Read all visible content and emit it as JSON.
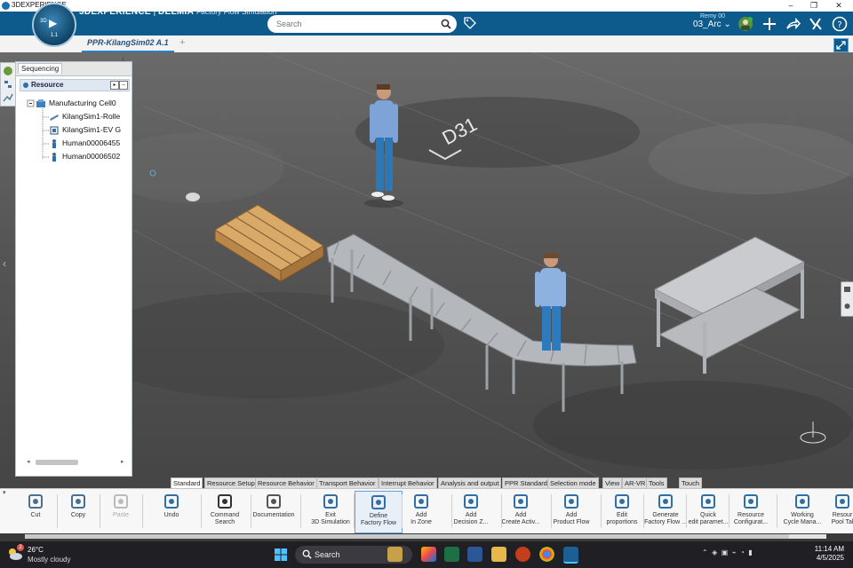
{
  "window": {
    "title": "3DEXPERIENCE",
    "controls": [
      "–",
      "❐",
      "✕"
    ]
  },
  "topbar": {
    "brand_bold": "3DEXPERIENCE",
    "brand_separator": " | ",
    "brand_app": "DELMIA",
    "brand_sub": "Factory Flow Simulation",
    "compass_3d": "3D",
    "compass_version": "1.1",
    "search_placeholder": "Search",
    "user_name": "Remy 00",
    "collab_space": "03_Arc"
  },
  "tabs": {
    "document": "PPR-KilangSim02 A.1",
    "add": "+"
  },
  "panel": {
    "tab": "Sequencing",
    "header": "Resource",
    "tree": [
      {
        "label": "Manufacturing Cell0"
      },
      {
        "label": "KilangSim1-Rolle"
      },
      {
        "label": "KilangSim1-EV G"
      },
      {
        "label": "Human00006455"
      },
      {
        "label": "Human00006502"
      }
    ]
  },
  "scene": {
    "floor_mark": "D31"
  },
  "actionbar_tabs": [
    {
      "label": "Standard",
      "active": true
    },
    {
      "label": "Resource Setup"
    },
    {
      "label": "Resource Behavior"
    },
    {
      "label": "Transport Behavior"
    },
    {
      "label": "Interrupt Behavior"
    },
    {
      "label": "Analysis and output"
    },
    {
      "label": "PPR Standard"
    },
    {
      "label": "Selection mode"
    },
    {
      "label": "View"
    },
    {
      "label": "AR-VR"
    },
    {
      "label": "Tools"
    },
    {
      "label": "Touch"
    }
  ],
  "actions": [
    {
      "icon": "scissors-icon",
      "l1": "Cut",
      "l2": ""
    },
    {
      "icon": "copy-icon",
      "l1": "Copy",
      "l2": ""
    },
    {
      "icon": "paste-icon",
      "l1": "Paste",
      "l2": ""
    },
    {
      "icon": "undo-icon",
      "l1": "Undo",
      "l2": ""
    },
    {
      "icon": "command-search-icon",
      "l1": "Command",
      "l2": "Search"
    },
    {
      "icon": "documentation-icon",
      "l1": "Documentation",
      "l2": ""
    },
    {
      "icon": "exit-icon",
      "l1": "Exit",
      "l2": "3D Simulation"
    },
    {
      "icon": "factory-flow-icon",
      "l1": "Define",
      "l2": "Factory Flow"
    },
    {
      "icon": "zone-icon",
      "l1": "Add",
      "l2": "In Zone"
    },
    {
      "icon": "decision-icon",
      "l1": "Add",
      "l2": "Decision Z..."
    },
    {
      "icon": "activity-icon",
      "l1": "Add",
      "l2": "Create Activ..."
    },
    {
      "icon": "product-flow-icon",
      "l1": "Add",
      "l2": "Product Flow"
    },
    {
      "icon": "proportions-icon",
      "l1": "Edit",
      "l2": "proportions"
    },
    {
      "icon": "generate-flow-icon",
      "l1": "Generate",
      "l2": "Factory Flow ..."
    },
    {
      "icon": "quick-edit-icon",
      "l1": "Quick",
      "l2": "edit paramet..."
    },
    {
      "icon": "resource-config-icon",
      "l1": "Resource",
      "l2": "Configurat..."
    },
    {
      "icon": "working-cycle-icon",
      "l1": "Working",
      "l2": "Cycle Mana..."
    },
    {
      "icon": "resource-pool-icon",
      "l1": "Resour",
      "l2": "Pool Tal"
    }
  ],
  "taskbar": {
    "weather_badge": "2",
    "temperature": "26°C",
    "condition": "Mostly cloudy",
    "search": "Search",
    "time": "11:14 AM",
    "date": "4/5/2025"
  },
  "colors": {
    "topbar": "#0d5a8c",
    "accent": "#2f7fc1",
    "taskbar": "#1f1f24"
  }
}
